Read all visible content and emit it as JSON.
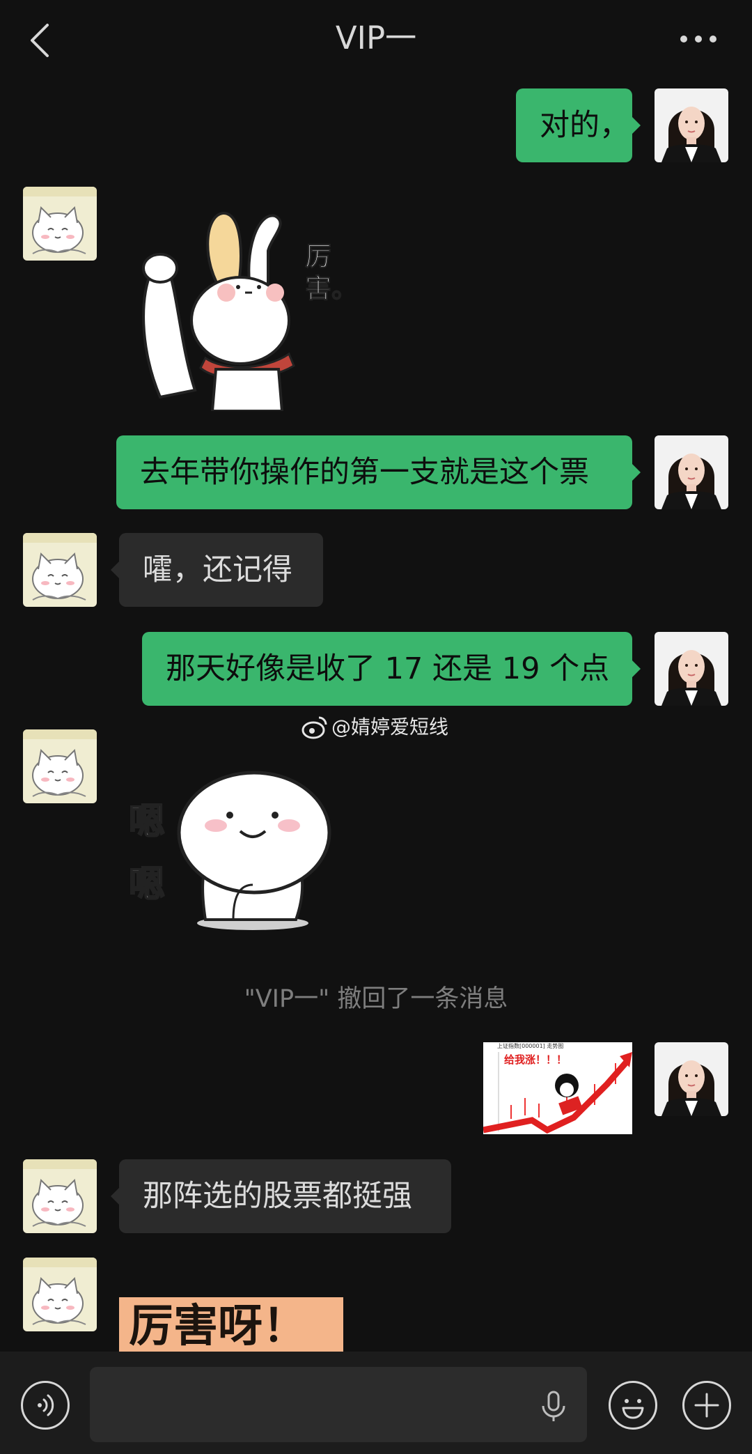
{
  "header": {
    "title": "VIP一",
    "back_icon": "chevron-left-icon",
    "more_icon": "more-horizontal-icon"
  },
  "messages": [
    {
      "sender": "me",
      "type": "text",
      "text": "对的，"
    },
    {
      "sender": "other",
      "type": "sticker",
      "sticker": "rabbit-thumbs-up",
      "caption": "厉害。"
    },
    {
      "sender": "me",
      "type": "text",
      "text": "去年带你操作的第一支就是这个票"
    },
    {
      "sender": "other",
      "type": "text",
      "text": "嚯，还记得"
    },
    {
      "sender": "me",
      "type": "text",
      "text": "那天好像是收了 17 还是 19 个点"
    },
    {
      "sender": "other",
      "type": "sticker",
      "sticker": "dumpling-nod",
      "caption": "嗯嗯"
    },
    {
      "sender": "me",
      "type": "image",
      "image": "stock-chart-thumbnail",
      "image_text": "给我涨！！！",
      "image_header": "上证指数[000001]  走势图"
    },
    {
      "sender": "other",
      "type": "text",
      "text": "那阵选的股票都挺强"
    },
    {
      "sender": "other",
      "type": "sticker",
      "sticker": "text-sticker",
      "caption": "厉害呀！"
    }
  ],
  "watermark": "@婧婷爱短线",
  "system_note": "\"VIP一\" 撤回了一条消息",
  "input_bar": {
    "voice_icon": "voice-icon",
    "mic_icon": "microphone-icon",
    "emoji_icon": "emoji-icon",
    "plus_icon": "plus-icon",
    "placeholder": ""
  },
  "colors": {
    "background": "#111111",
    "my_bubble": "#3ab66d",
    "other_bubble": "#2b2b2b",
    "input_bar": "#1c1c1c"
  }
}
